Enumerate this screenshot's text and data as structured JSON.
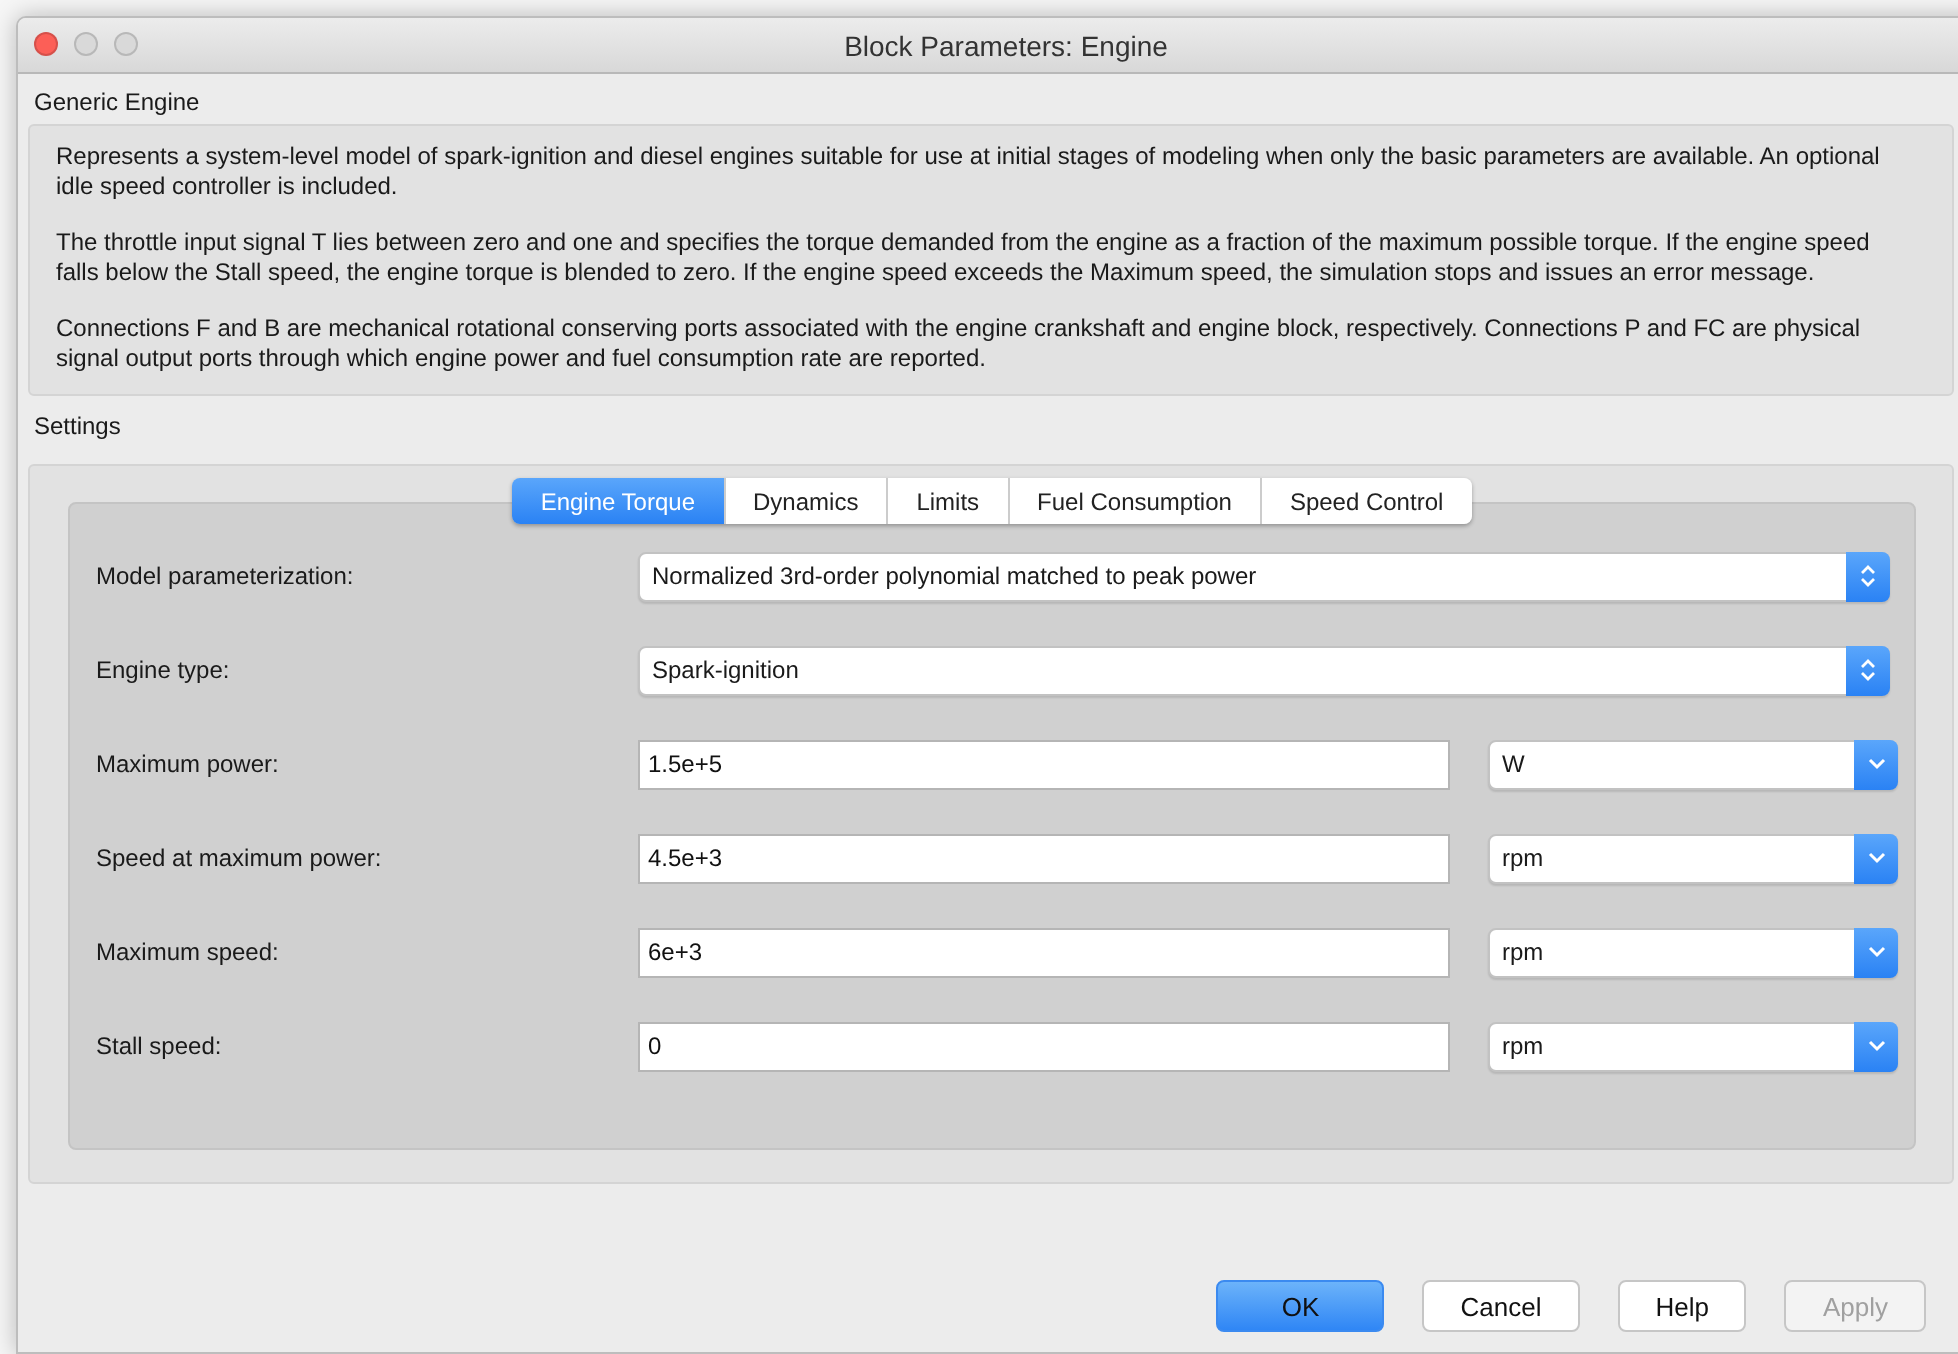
{
  "window": {
    "title": "Block Parameters: Engine"
  },
  "description": {
    "title": "Generic Engine",
    "paragraphs": [
      "Represents a system-level model of spark-ignition and diesel engines suitable for use at initial stages of modeling when only the basic parameters are available. An optional idle speed controller is included.",
      "The throttle input signal T lies between zero and one and specifies the torque demanded from the engine as a fraction of the maximum possible torque. If the engine speed falls below the Stall speed, the engine torque is blended to zero. If the engine speed exceeds the Maximum speed, the simulation stops and issues an error message.",
      "Connections F and B are mechanical rotational conserving ports associated with the engine crankshaft and engine block, respectively. Connections P and FC are physical signal output ports through which engine power and fuel consumption rate are reported."
    ]
  },
  "settings": {
    "title": "Settings",
    "tabs": [
      {
        "label": "Engine Torque",
        "selected": true
      },
      {
        "label": "Dynamics",
        "selected": false
      },
      {
        "label": "Limits",
        "selected": false
      },
      {
        "label": "Fuel Consumption",
        "selected": false
      },
      {
        "label": "Speed Control",
        "selected": false
      }
    ],
    "parameters": [
      {
        "label": "Model parameterization:",
        "kind": "select",
        "value": "Normalized 3rd-order polynomial matched to peak power"
      },
      {
        "label": "Engine type:",
        "kind": "select",
        "value": "Spark-ignition"
      },
      {
        "label": "Maximum power:",
        "kind": "value_unit",
        "value": "1.5e+5",
        "unit": "W"
      },
      {
        "label": "Speed at maximum power:",
        "kind": "value_unit",
        "value": "4.5e+3",
        "unit": "rpm"
      },
      {
        "label": "Maximum speed:",
        "kind": "value_unit",
        "value": "6e+3",
        "unit": "rpm"
      },
      {
        "label": "Stall speed:",
        "kind": "value_unit",
        "value": "0",
        "unit": "rpm"
      }
    ]
  },
  "buttons": [
    {
      "label": "OK",
      "default": true,
      "disabled": false
    },
    {
      "label": "Cancel",
      "default": false,
      "disabled": false
    },
    {
      "label": "Help",
      "default": false,
      "disabled": false
    },
    {
      "label": "Apply",
      "default": false,
      "disabled": true
    }
  ]
}
